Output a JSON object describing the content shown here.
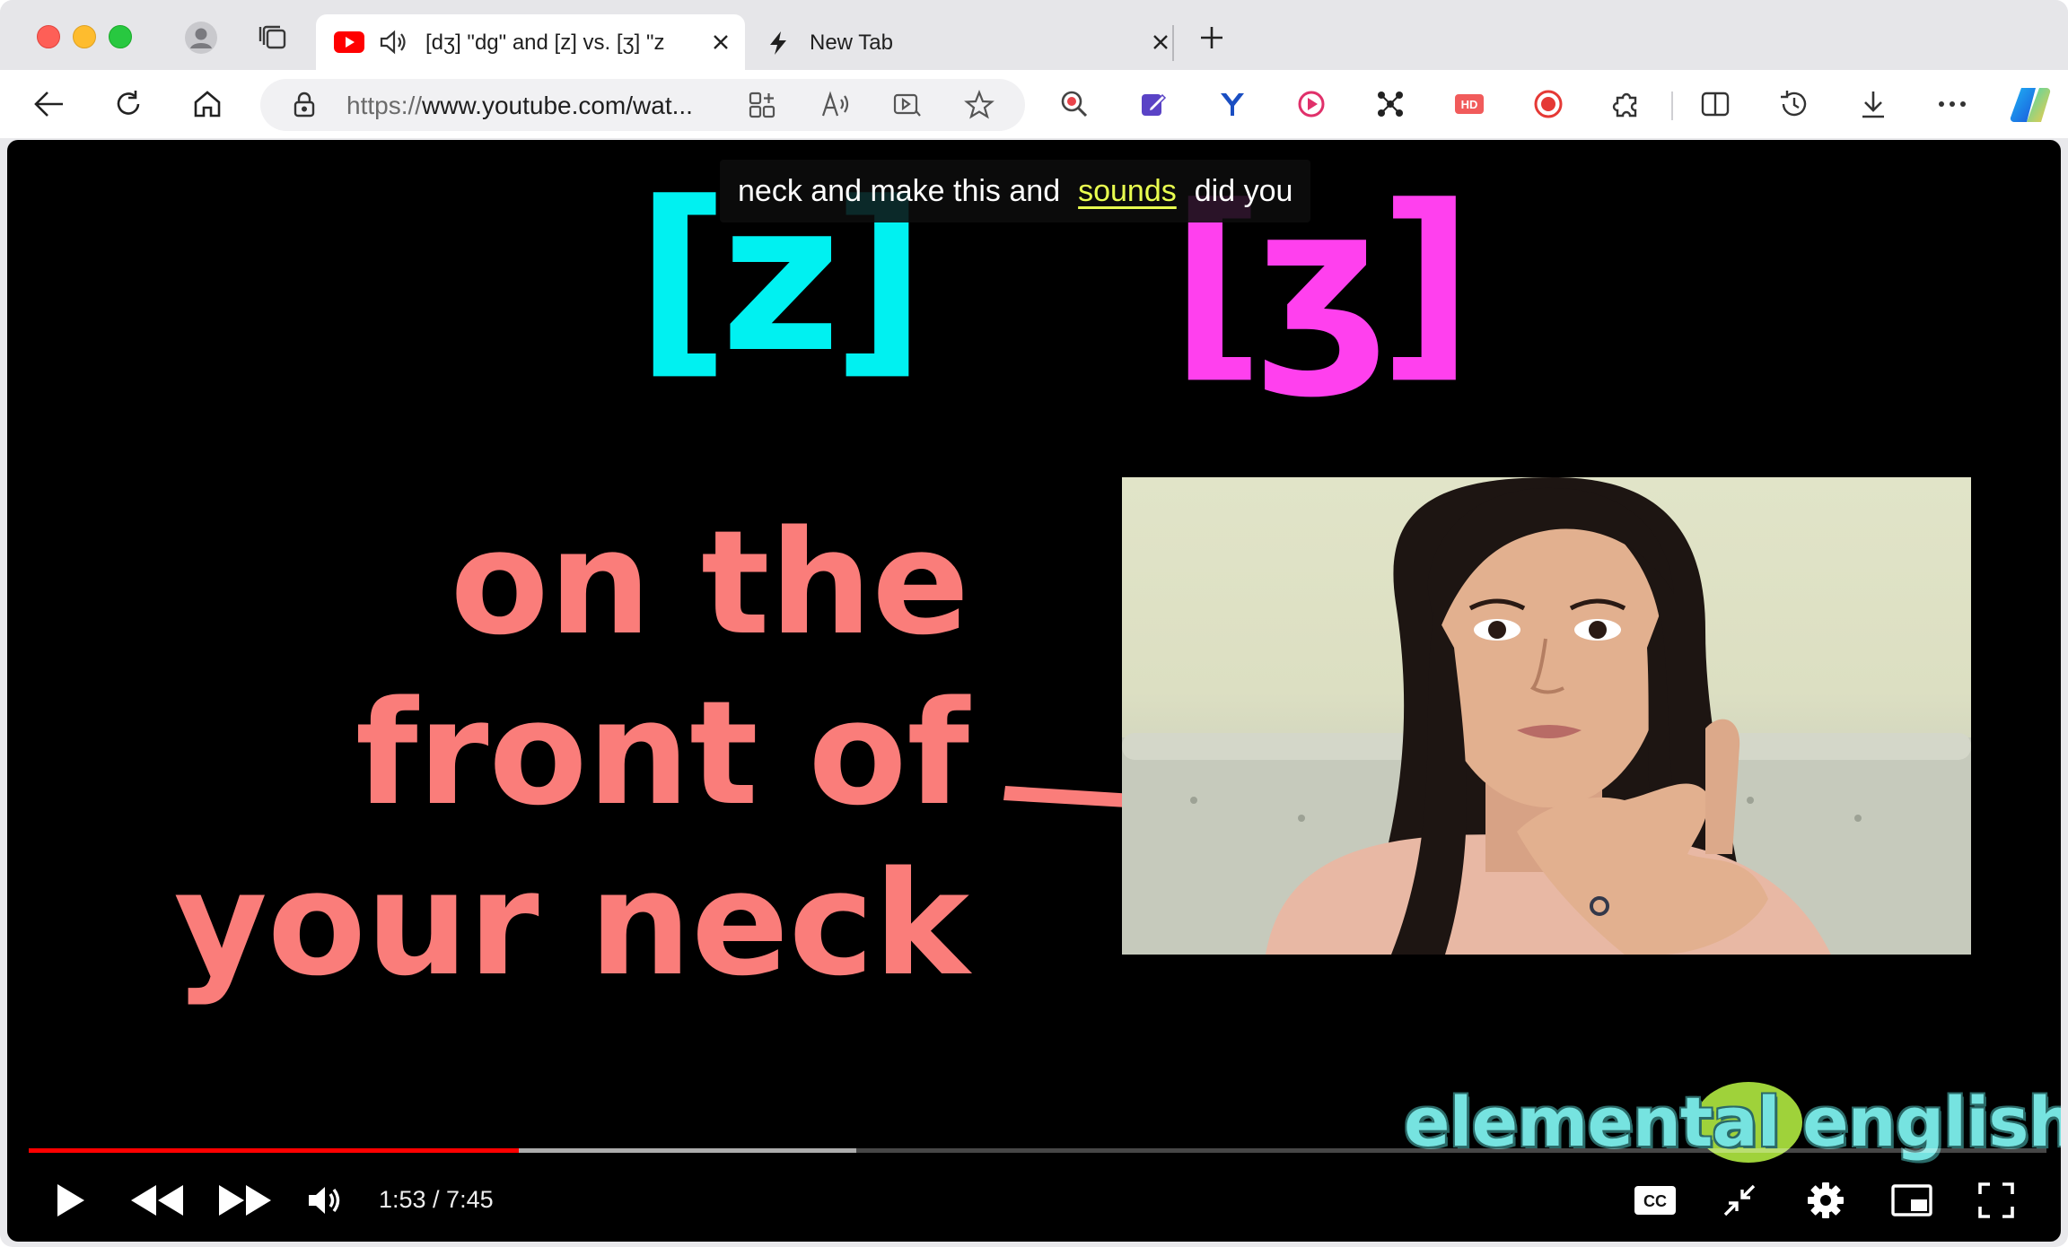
{
  "browser": {
    "tabs": [
      {
        "title": "[dʒ] \"dg\" and [z] vs. [ʒ] \"z",
        "icon": "youtube-icon",
        "active": true
      },
      {
        "title": "New Tab",
        "icon": "lightning-icon",
        "active": false
      }
    ],
    "address": {
      "scheme": "https://",
      "rest": "www.youtube.com/wat..."
    },
    "colors": {
      "accent": "#ff0000"
    }
  },
  "video": {
    "ipa_left": "[z]",
    "ipa_right": "[ʒ]",
    "caption": {
      "before": "neck and make this and",
      "highlight": "sounds",
      "after": "did you"
    },
    "slide_lines": [
      "on the",
      "front of",
      "your neck"
    ],
    "watermark": "elemental english",
    "current_time": "1:53",
    "duration": "7:45",
    "timecode": "1:53 / 7:45",
    "progress_played_fraction": 0.243,
    "progress_buffered_fraction": 0.41,
    "colors": {
      "ipa_z": "#00f1f1",
      "ipa_zh": "#ff40ee",
      "slide_text": "#fa7d7a",
      "caption_highlight": "#e9ff4f"
    }
  }
}
